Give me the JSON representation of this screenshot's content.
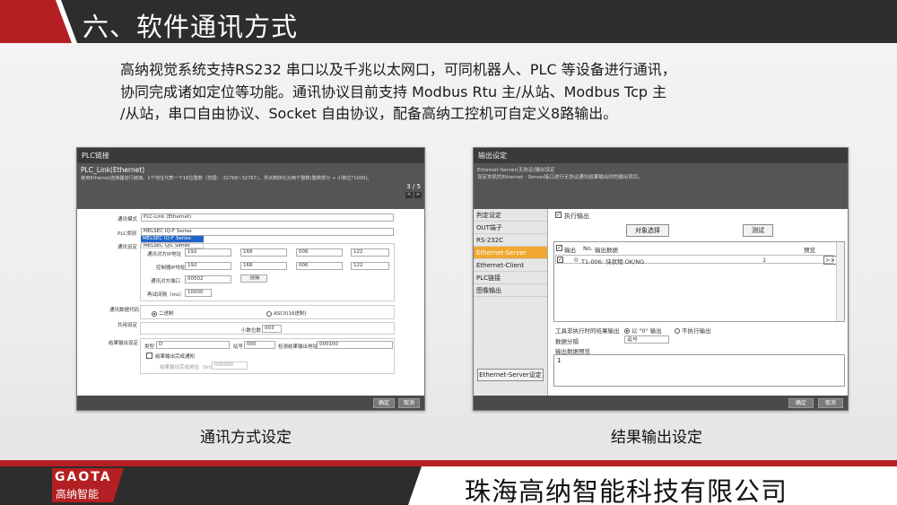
{
  "header": {
    "title": "六、软件通讯方式"
  },
  "intro": {
    "lines": [
      "高纳视觉系统支持RS232 串口以及千兆以太网口，可同机器人、PLC 等设备进行通讯，",
      "协同完成诸如定位等功能。通讯协议目前支持 Modbus Rtu 主/从站、Modbus Tcp 主",
      "/从站，串口自由协议、Socket 自由协议，配备高纳工控机可自定义8路输出。"
    ]
  },
  "plc": {
    "title": "PLC链接",
    "sub": "PLC_Link(Ethernet)",
    "desc": "使用Ethernet连接器进行链接。1个地址代表一个16位整数（范围：-32768~32767），浮点数转化为两个整数(整数部分 + 小数位*1000)。",
    "page": "3 / 5",
    "prev": "<",
    "next": ">",
    "mode_label": "通讯模式",
    "mode_value": "PLC-Link (Ethernet)",
    "type_label": "PLC类别",
    "type_value": "MELSEC IQ-F Series",
    "type_opt1": "MELSEC IQ-F Series",
    "type_opt2": "MELSEC Q/L Series",
    "comm_label": "通讯设定",
    "ip_label": "通讯对方IP地址",
    "ip": [
      "192",
      "168",
      "006",
      "122"
    ],
    "ctrl_label": "控制器IP地址",
    "ctrl": [
      "192",
      "168",
      "006",
      "122"
    ],
    "port_label": "通讯对方端口",
    "port": "00502",
    "connect": "连接",
    "cycle_label": "再试间隔（ms）",
    "cycle": "10000",
    "code_label": "通讯数据代码",
    "binary": "二进制",
    "ascii": "ASCII(16进制)",
    "shared_label": "共用设定",
    "decimal_label": "小数位数",
    "decimal": "003",
    "result_label": "结果输出设定",
    "rtype_label": "类型",
    "rtype": "D",
    "addr_label": "站号",
    "addr": "000",
    "detect_label": "检测结果输出地址",
    "detect": "000100",
    "notify_label": "结果输出完成通知",
    "notify_addr_label": "结果输出完成地址（bit）",
    "notify_addr": "000000",
    "ok": "确定",
    "cancel": "取消"
  },
  "out": {
    "title": "输出设定",
    "line1": "Ethernet-Server(无协议)输出设定",
    "line2": "设定本机的Ethernet - Server接口进行无协议通讯结果输出时的输出项目。",
    "side": [
      "判定设定",
      "OUT端子",
      "RS-232C",
      "Ethernet-Server",
      "Ethernet-Client",
      "PLC链接",
      "图像输出"
    ],
    "side_btn": "Ethernet-Server设定",
    "exec": "执行输出",
    "obj_btn": "对象选择",
    "test_btn": "测试",
    "col_out": "输出",
    "col_no": "No.",
    "col_data": "输出数据",
    "col_preview": "预览",
    "row": {
      "no": "0",
      "data": "T1-006: 块状物  OK/NG",
      "preview": "1",
      "more": ">>"
    },
    "tool_label": "工具非执行时的结果输出",
    "opt_zero": "以 \"0\" 输出",
    "opt_none": "不执行输出",
    "sep_label": "数据分隔",
    "sep_value": "逗号",
    "preview_label": "输出数据预览",
    "preview_value": "1",
    "ok": "确定",
    "cancel": "取消"
  },
  "captions": {
    "left": "通讯方式设定",
    "right": "结果输出设定"
  },
  "footer": {
    "logo": "GAOTA",
    "logo_cn": "高纳智能",
    "company": "珠海高纳智能科技有限公司"
  }
}
